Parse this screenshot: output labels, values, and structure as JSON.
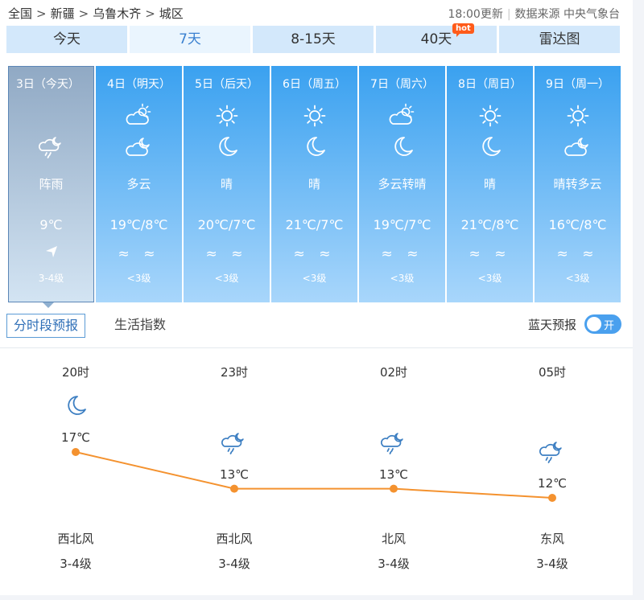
{
  "breadcrumb": {
    "items": [
      "全国",
      "新疆",
      "乌鲁木齐",
      "城区"
    ],
    "separator": ">"
  },
  "meta": {
    "update": "18:00更新",
    "source": "数据来源 中央气象台"
  },
  "tabs": [
    {
      "label": "今天",
      "active": false
    },
    {
      "label": "7天",
      "active": true
    },
    {
      "label": "8-15天",
      "active": false
    },
    {
      "label": "40天",
      "active": false,
      "badge": "hot"
    },
    {
      "label": "雷达图",
      "active": false
    }
  ],
  "days": [
    {
      "date": "3日（今天）",
      "icon_day": "",
      "icon_night": "shower-night-icon",
      "desc": "阵雨",
      "temp": "9℃",
      "wind_level": "3-4级",
      "wind_icon": "wind-direction-arrow-icon"
    },
    {
      "date": "4日（明天）",
      "icon_day": "partly-cloudy-day-icon",
      "icon_night": "partly-cloudy-night-icon",
      "desc": "多云",
      "temp": "19℃/8℃",
      "wind_icon": "wind-waves-icon",
      "wind_level": "<3级"
    },
    {
      "date": "5日（后天）",
      "icon_day": "sun-icon",
      "icon_night": "moon-icon",
      "desc": "晴",
      "temp": "20℃/7℃",
      "wind_icon": "wind-waves-icon",
      "wind_level": "<3级"
    },
    {
      "date": "6日（周五）",
      "icon_day": "sun-icon",
      "icon_night": "moon-icon",
      "desc": "晴",
      "temp": "21℃/7℃",
      "wind_icon": "wind-waves-icon",
      "wind_level": "<3级"
    },
    {
      "date": "7日（周六）",
      "icon_day": "partly-cloudy-day-icon",
      "icon_night": "moon-icon",
      "desc": "多云转晴",
      "temp": "19℃/7℃",
      "wind_icon": "wind-waves-icon",
      "wind_level": "<3级"
    },
    {
      "date": "8日（周日）",
      "icon_day": "sun-icon",
      "icon_night": "moon-icon",
      "desc": "晴",
      "temp": "21℃/8℃",
      "wind_icon": "wind-waves-icon",
      "wind_level": "<3级"
    },
    {
      "date": "9日（周一）",
      "icon_day": "sun-icon",
      "icon_night": "partly-cloudy-night-icon",
      "desc": "晴转多云",
      "temp": "16℃/8℃",
      "wind_icon": "wind-waves-icon",
      "wind_level": "<3级"
    }
  ],
  "wave_glyphs": "≈ ≈",
  "subtabs": [
    {
      "label": "分时段预报",
      "active": true
    },
    {
      "label": "生活指数",
      "active": false
    }
  ],
  "bluesky": {
    "label": "蓝天预报",
    "toggle_text": "开"
  },
  "hourly": [
    {
      "time": "20时",
      "icon": "moon-icon",
      "temp": "17℃",
      "temp_value": 17,
      "wind_dir": "西北风",
      "wind_level": "3-4级"
    },
    {
      "time": "23时",
      "icon": "shower-night-icon",
      "temp": "13℃",
      "temp_value": 13,
      "wind_dir": "西北风",
      "wind_level": "3-4级"
    },
    {
      "time": "02时",
      "icon": "shower-night-icon",
      "temp": "13℃",
      "temp_value": 13,
      "wind_dir": "北风",
      "wind_level": "3-4级"
    },
    {
      "time": "05时",
      "icon": "shower-night-icon",
      "temp": "12℃",
      "temp_value": 12,
      "wind_dir": "东风",
      "wind_level": "3-4级"
    }
  ],
  "colors": {
    "accent": "#3a80d0",
    "day_gradient_top": "#3aa1f0",
    "line": "#f4922f",
    "hour_icon": "#3d7fc2"
  }
}
